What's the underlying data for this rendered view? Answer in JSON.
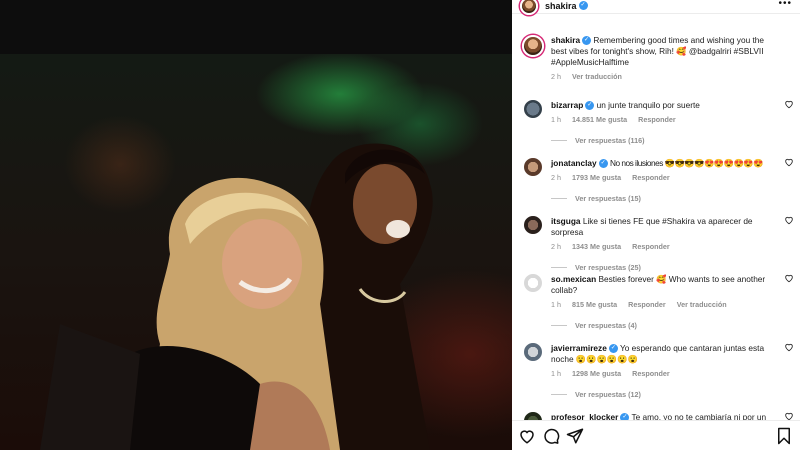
{
  "post": {
    "author": "shakira",
    "caption_user": "shakira",
    "caption_text": "Remembering good times and wishing you the best vibes for tonight's show, Rih! 🥰 @badgalriri #SBLVII #AppleMusicHalftime",
    "caption_time": "2 h",
    "caption_translate": "Ver traducción"
  },
  "comments": [
    {
      "user": "bizarrap",
      "verified": true,
      "text": "un junte tranquilo por suerte",
      "time": "1 h",
      "likes": "14.851 Me gusta",
      "reply": "Responder",
      "translate": "",
      "replies": "Ver respuestas (116)"
    },
    {
      "user": "jonatanclay",
      "verified": true,
      "text": "No nos ilusiones 😎😎😎😎😍😍😍😍😍😍",
      "time": "2 h",
      "likes": "1793 Me gusta",
      "reply": "Responder",
      "translate": "",
      "replies": "Ver respuestas (15)"
    },
    {
      "user": "itsguga",
      "verified": false,
      "text": "Like si tienes FE que #Shakira va aparecer de sorpresa",
      "time": "2 h",
      "likes": "1343 Me gusta",
      "reply": "Responder",
      "translate": "",
      "replies": "Ver respuestas (25)"
    },
    {
      "user": "so.mexican",
      "verified": false,
      "text": "Besties forever 🥰 Who wants to see another collab?",
      "time": "1 h",
      "likes": "815 Me gusta",
      "reply": "Responder",
      "translate": "Ver traducción",
      "replies": "Ver respuestas (4)"
    },
    {
      "user": "javierramireze",
      "verified": true,
      "text": "Yo esperando que cantaran juntas esta noche 😮😮😮😮😮😮",
      "time": "1 h",
      "likes": "1298 Me gusta",
      "reply": "Responder",
      "translate": "",
      "replies": "Ver respuestas (12)"
    },
    {
      "user": "profesor_klocker",
      "verified": true,
      "text": "Te amo, yo no te cambiaría ni por un",
      "time": "",
      "likes": "",
      "reply": "",
      "translate": "",
      "replies": ""
    }
  ],
  "icons": {
    "like": "heart-icon",
    "comment": "comment-icon",
    "share": "share-icon",
    "save": "bookmark-icon",
    "more": "more-options-icon"
  },
  "colors": {
    "link": "#00376b",
    "verified": "#3897f0",
    "meta": "#8e8e8e"
  }
}
